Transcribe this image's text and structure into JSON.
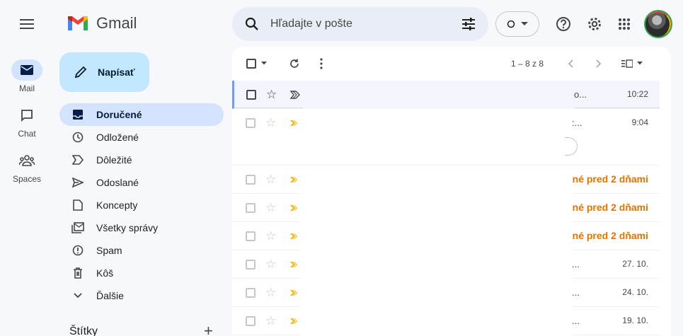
{
  "header": {
    "app_name": "Gmail",
    "search_placeholder": "Hľadajte v pošte"
  },
  "rail": [
    {
      "label": "Mail",
      "icon": "mail-icon",
      "active": true
    },
    {
      "label": "Chat",
      "icon": "chat-icon",
      "active": false
    },
    {
      "label": "Spaces",
      "icon": "spaces-icon",
      "active": false
    }
  ],
  "compose": {
    "label": "Napísať"
  },
  "nav": [
    {
      "label": "Doručené",
      "icon": "inbox-icon",
      "active": true
    },
    {
      "label": "Odložené",
      "icon": "clock-icon"
    },
    {
      "label": "Dôležité",
      "icon": "label-important-icon"
    },
    {
      "label": "Odoslané",
      "icon": "send-icon"
    },
    {
      "label": "Koncepty",
      "icon": "draft-icon"
    },
    {
      "label": "Všetky správy",
      "icon": "all-mail-icon"
    },
    {
      "label": "Spam",
      "icon": "spam-icon"
    },
    {
      "label": "Kôš",
      "icon": "trash-icon"
    },
    {
      "label": "Ďalšie",
      "icon": "chevron-down-icon"
    }
  ],
  "labels_header": "Štítky",
  "toolbar": {
    "range": "1 – 8 z 8"
  },
  "emails": [
    {
      "fragment": "o...",
      "time": "10:22",
      "bold_time": false
    },
    {
      "fragment": ":...",
      "time": "9:04",
      "bold_time": false
    },
    {
      "fragment": "",
      "time": "né pred 2 dňami",
      "bold_time": true
    },
    {
      "fragment": "",
      "time": "né pred 2 dňami",
      "bold_time": true
    },
    {
      "fragment": "",
      "time": "né pred 2 dňami",
      "bold_time": true
    },
    {
      "fragment": "...",
      "time": "27. 10.",
      "bold_time": false
    },
    {
      "fragment": "...",
      "time": "24. 10.",
      "bold_time": false
    },
    {
      "fragment": "...",
      "time": "19. 10.",
      "bold_time": false
    }
  ],
  "colors": {
    "accent": "#0b57d0",
    "important": "#f4b400",
    "date_highlight": "#e37400"
  }
}
